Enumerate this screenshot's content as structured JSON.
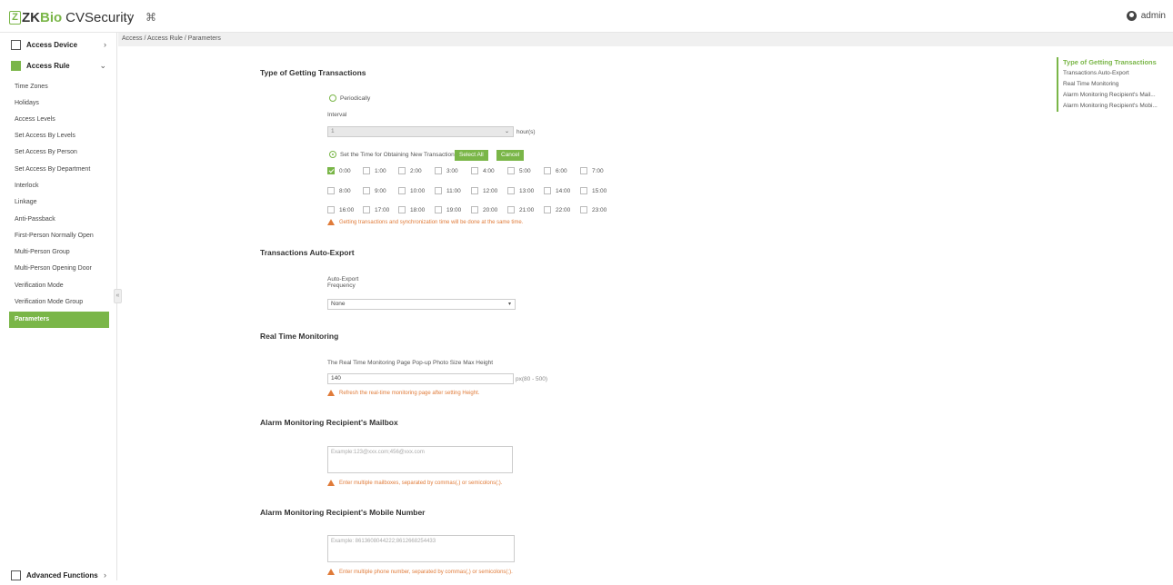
{
  "header": {
    "logo_zk": "ZK",
    "logo_bio": "Bio",
    "logo_cvs": "CVSecurity",
    "user": "admin"
  },
  "sidebar": {
    "access_device": "Access Device",
    "access_rule": "Access Rule",
    "items": [
      "Time Zones",
      "Holidays",
      "Access Levels",
      "Set Access By Levels",
      "Set Access By Person",
      "Set Access By Department",
      "Interlock",
      "Linkage",
      "Anti-Passback",
      "First-Person Normally Open",
      "Multi-Person Group",
      "Multi-Person Opening Door",
      "Verification Mode",
      "Verification Mode Group",
      "Parameters"
    ],
    "advanced": "Advanced Functions"
  },
  "breadcrumb": "Access / Access Rule / Parameters",
  "transactions": {
    "title": "Type of Getting Transactions",
    "periodically": "Periodically",
    "interval_label": "Interval",
    "interval_value": "1",
    "interval_unit": "hour(s)",
    "set_time_label": "Set the Time for Obtaining New Transactions",
    "select_all": "Select All",
    "cancel": "Cancel",
    "hours": [
      "0:00",
      "1:00",
      "2:00",
      "3:00",
      "4:00",
      "5:00",
      "6:00",
      "7:00",
      "8:00",
      "9:00",
      "10:00",
      "11:00",
      "12:00",
      "13:00",
      "14:00",
      "15:00",
      "16:00",
      "17:00",
      "18:00",
      "19:00",
      "20:00",
      "21:00",
      "22:00",
      "23:00"
    ],
    "warning": "Getting transactions and synchronization time will be done at the same time."
  },
  "auto_export": {
    "title": "Transactions Auto-Export",
    "label_line1": "Auto-Export",
    "label_line2": "Frequency",
    "value": "None"
  },
  "realtime": {
    "title": "Real Time Monitoring",
    "label": "The Real Time Monitoring Page Pop-up Photo Size   Max Height",
    "value": "140",
    "unit": "px(80 - 500)",
    "warning": "Refresh the real-time monitoring page after setting Height."
  },
  "mailbox": {
    "title": "Alarm Monitoring Recipient's Mailbox",
    "placeholder": "Example:123@xxx.com;456@xxx.com",
    "warning": "Enter multiple mailboxes, separated by commas(,) or semicolons(;)."
  },
  "mobile": {
    "title": "Alarm Monitoring Recipient's Mobile Number",
    "placeholder": "Example: 8613608044222;8612668254433",
    "warning": "Enter multiple phone number, separated by commas(,) or semicolons(;)."
  },
  "anchor_nav": [
    "Type of Getting Transactions",
    "Transactions Auto-Export",
    "Real Time Monitoring",
    "Alarm Monitoring Recipient's Mail...",
    "Alarm Monitoring Recipient's Mobi..."
  ],
  "colors": {
    "accent": "#7ab648",
    "warning": "#e07b39"
  }
}
